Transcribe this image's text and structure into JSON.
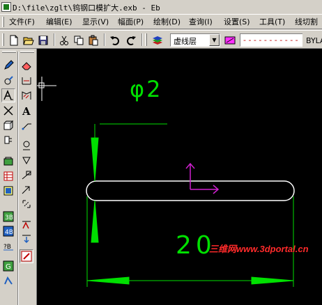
{
  "window": {
    "title": "D:\\file\\zglt\\钨钢口模扩大.exb - Eb"
  },
  "menubar": {
    "items": [
      "文件(F)",
      "编辑(E)",
      "显示(V)",
      "幅面(P)",
      "绘制(D)",
      "查询(I)",
      "设置(S)",
      "工具(T)",
      "线切割"
    ]
  },
  "toolbar": {
    "layer_combo_value": "虚线层",
    "linetype_value": "- - - - - - - - - - -",
    "bylayer_label": "BYLA"
  },
  "drawing": {
    "diameter_label": "φ2",
    "length_label": "20",
    "line_color": "#00e000",
    "axis_color": "#d020d0"
  },
  "watermark": {
    "part1": "三维网",
    "part2": "www.3dportal.cn"
  }
}
